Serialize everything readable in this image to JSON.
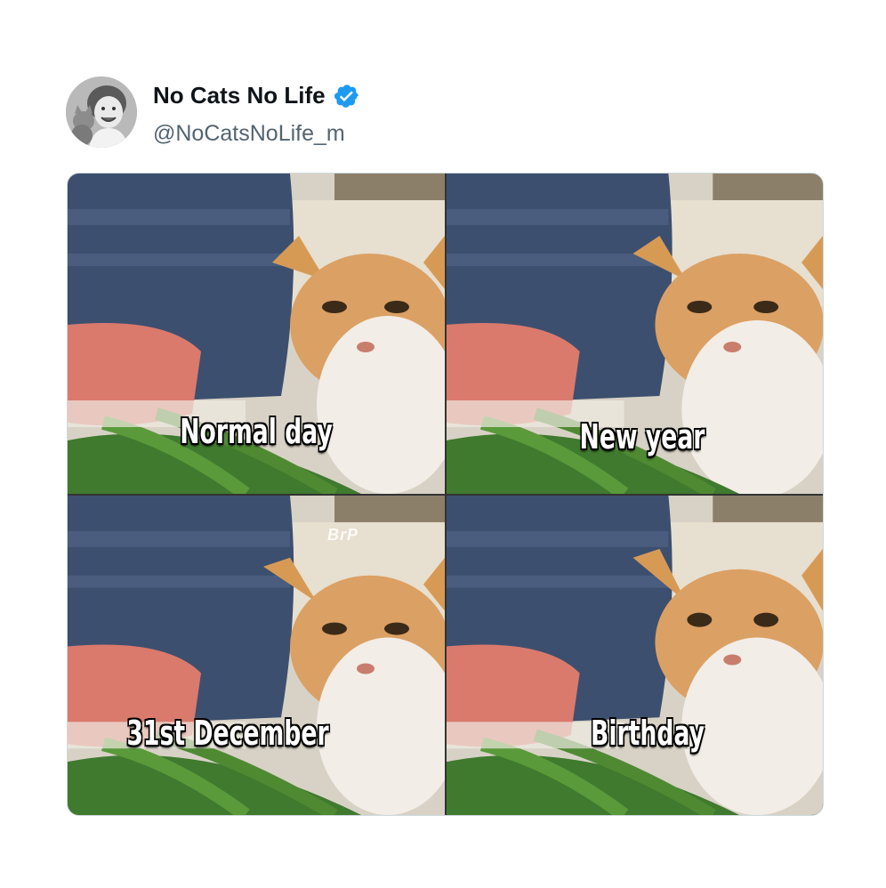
{
  "tweet": {
    "author": {
      "display_name": "No Cats No Life",
      "handle": "@NoCatsNoLife_m",
      "verified": true,
      "verified_color": "#1d9bf0"
    },
    "media": {
      "panels": [
        {
          "caption": "Normal day"
        },
        {
          "caption": "New year"
        },
        {
          "caption": "31st December"
        },
        {
          "caption": "Birthday"
        }
      ],
      "watermark": "BrP"
    }
  },
  "icons": {
    "verified": "verified-badge-icon",
    "avatar": "profile-avatar"
  }
}
